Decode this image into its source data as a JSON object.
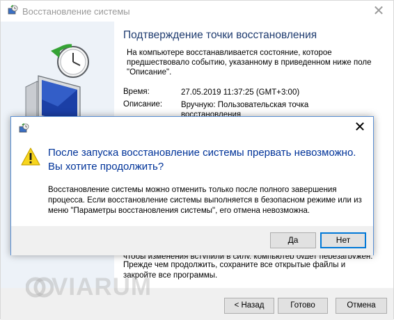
{
  "wizard": {
    "title": "Восстановление системы",
    "heading": "Подтверждение точки восстановления",
    "intro": "На компьютере восстанавливается состояние, которое предшествовало событию, указанному в приведенном ниже поле \"Описание\".",
    "time_label": "Время:",
    "time_value": "27.05.2019 11:37:25 (GMT+3:00)",
    "desc_label": "Описание:",
    "desc_value": "Вручную: Пользовательская точка восстановления",
    "cut_line": "чтобы изменения вступили в силу, компьютер будет перезагружен.",
    "bottom_text": "Прежде чем продолжить, сохраните все открытые файлы и закройте все программы.",
    "buttons": {
      "back": "< Назад",
      "finish": "Готово",
      "cancel": "Отмена"
    }
  },
  "dialog": {
    "main_instruction": "После запуска восстановление системы прервать невозможно. Вы хотите продолжить?",
    "content": "Восстановление системы можно отменить только после полного завершения процесса. Если восстановление системы выполняется в безопасном режиме или из меню \"Параметры восстановления системы\", его отмена невозможна.",
    "yes": "Да",
    "no": "Нет"
  },
  "watermark": "VIARUM",
  "colors": {
    "heading": "#1e3b6f",
    "main_instruction": "#003399",
    "accent_border": "#0078d7"
  },
  "icons": [
    "system-restore-icon",
    "warning-icon",
    "close-icon",
    "restore-monitor-clock-icon"
  ]
}
